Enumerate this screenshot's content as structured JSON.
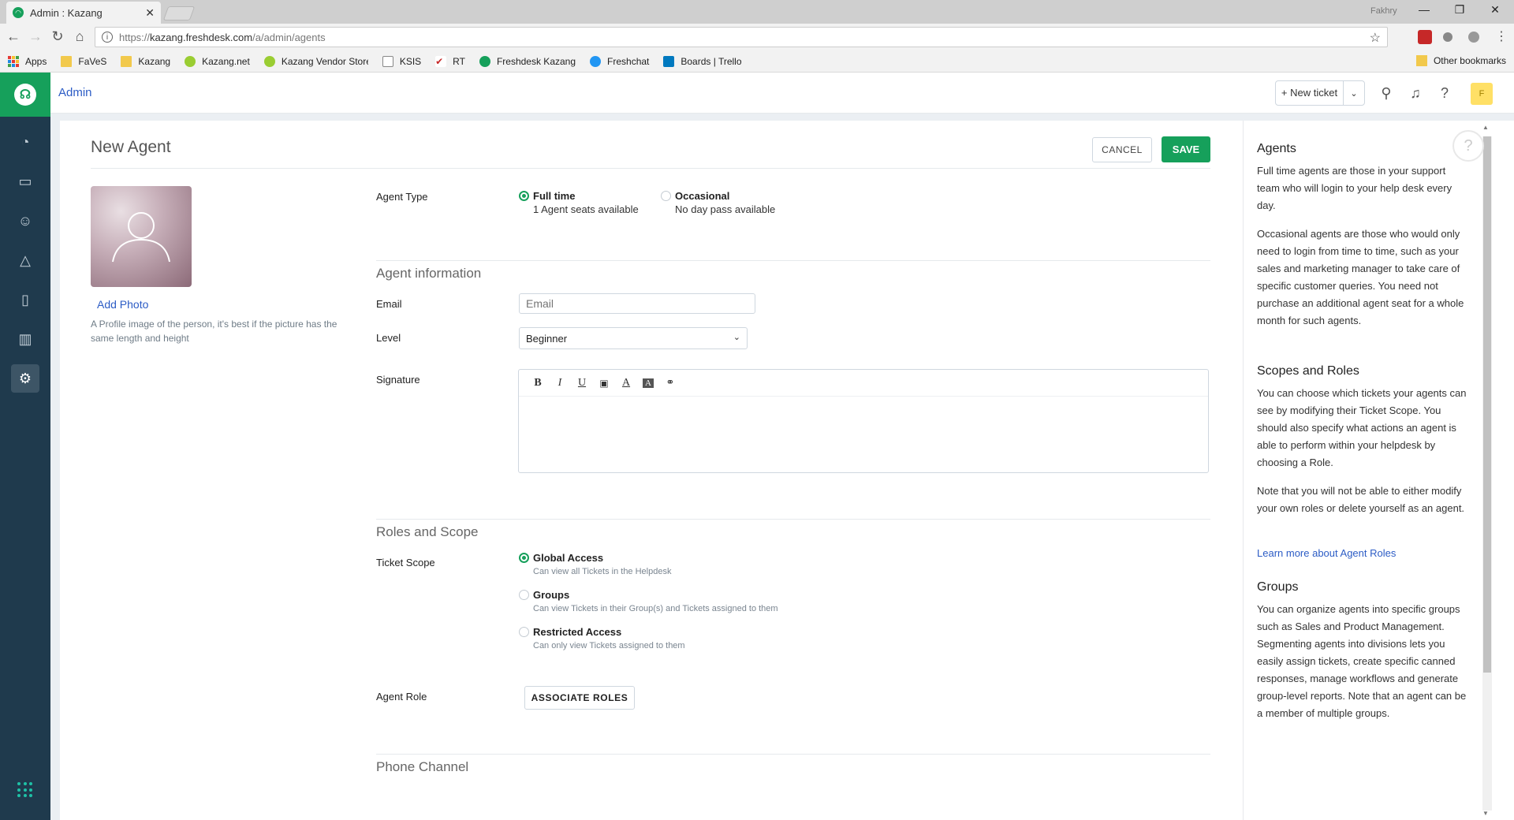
{
  "browser": {
    "tab_title": "Admin : Kazang",
    "tab_close": "✕",
    "user": "Fakhry",
    "url_protocol": "https://",
    "url_host": "kazang.freshdesk.com",
    "url_path": "/a/admin/agents",
    "bookmarks": [
      "Apps",
      "FaVeS",
      "Kazang",
      "Kazang.net",
      "Kazang Vendor Store",
      "KSIS",
      "RT",
      "Freshdesk Kazang",
      "Freshchat",
      "Boards | Trello"
    ],
    "other_bookmarks": "Other bookmarks"
  },
  "header": {
    "breadcrumb": "Admin",
    "new_ticket": "+ New ticket",
    "avatar_initial": "F"
  },
  "form": {
    "title": "New Agent",
    "cancel": "CANCEL",
    "save": "SAVE",
    "add_photo": "Add Photo",
    "photo_hint": "A Profile image of the person, it's best if the picture has the same length and height",
    "agent_type_label": "Agent Type",
    "agent_type": {
      "full_time": {
        "title": "Full time",
        "sub": "1 Agent seats available",
        "selected": true
      },
      "occasional": {
        "title": "Occasional",
        "sub": "No day pass available",
        "selected": false
      }
    },
    "agent_info_title": "Agent information",
    "email_label": "Email",
    "email_placeholder": "Email",
    "level_label": "Level",
    "level_value": "Beginner",
    "signature_label": "Signature",
    "roles_title": "Roles and Scope",
    "ticket_scope_label": "Ticket Scope",
    "scopes": [
      {
        "title": "Global Access",
        "sub": "Can view all Tickets in the Helpdesk",
        "selected": true
      },
      {
        "title": "Groups",
        "sub": "Can view Tickets in their Group(s) and Tickets assigned to them",
        "selected": false
      },
      {
        "title": "Restricted Access",
        "sub": "Can only view Tickets assigned to them",
        "selected": false
      }
    ],
    "agent_role_label": "Agent Role",
    "associate_roles": "ASSOCIATE ROLES",
    "phone_title": "Phone Channel"
  },
  "help": {
    "agents_title": "Agents",
    "agents_p1": "Full time agents are those in your support team who will login to your help desk every day.",
    "agents_p2": "Occasional agents are those who would only need to login from time to time, such as your sales and marketing manager to take care of specific customer queries. You need not purchase an additional agent seat for a whole month for such agents.",
    "scopes_title": "Scopes and Roles",
    "scopes_p1": "You can choose which tickets your agents can see by modifying their Ticket Scope. You should also specify what actions an agent is able to perform within your helpdesk by choosing a Role.",
    "scopes_p2": "Note that you will not be able to either modify your own roles or delete yourself as an agent.",
    "learn_more": "Learn more about Agent Roles",
    "groups_title": "Groups",
    "groups_p1": "You can organize agents into specific groups such as Sales and Product Management. Segmenting agents into divisions lets you easily assign tickets, create specific canned responses, manage workflows and generate group-level reports. Note that an agent can be a member of multiple groups."
  },
  "colors": {
    "brand_green": "#16a05b",
    "sidebar": "#1f3a4d",
    "link": "#2c5cc5"
  }
}
